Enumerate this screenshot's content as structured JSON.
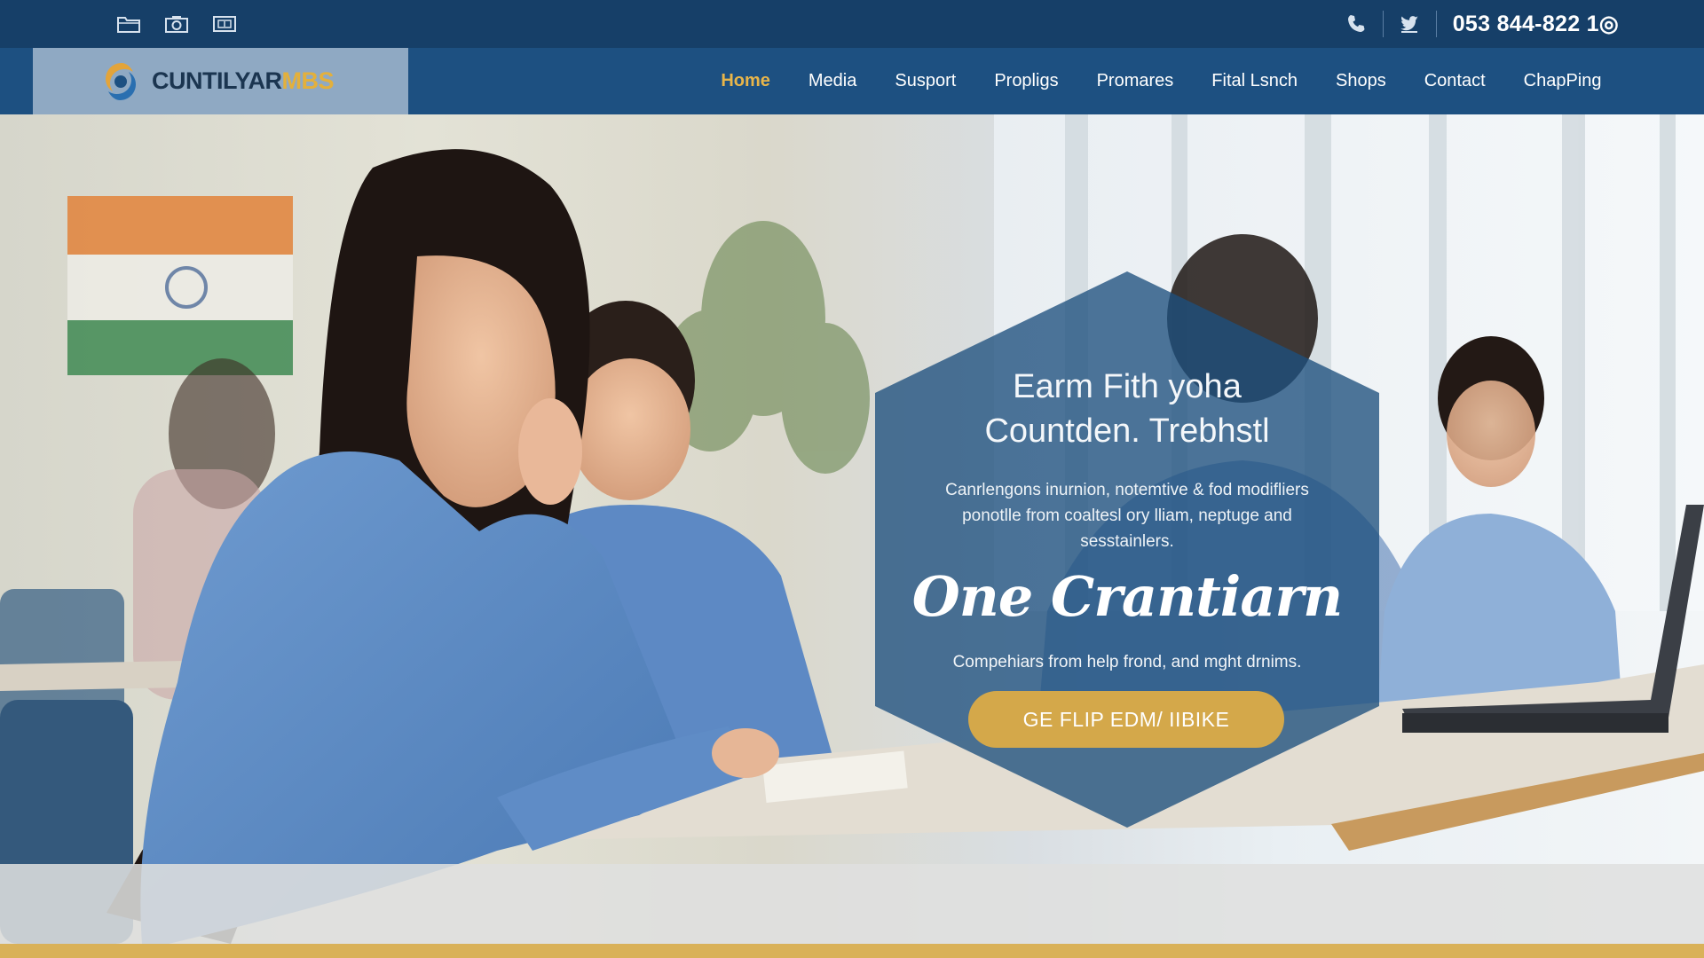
{
  "topbar": {
    "left_icons": [
      "folder-icon",
      "camera-icon",
      "ticket-icon"
    ],
    "right_icons": [
      "phone-icon",
      "twitter-icon"
    ],
    "phone": "053 844-822 1◎"
  },
  "brand": {
    "logo_text_a": "CUNTILYAR",
    "logo_text_b": "MBS",
    "colors": {
      "primary": "#1d5081",
      "dark": "#163f68",
      "gold": "#d4a84a",
      "logo_box": "#8fa9c3"
    }
  },
  "nav": {
    "items": [
      {
        "label": "Home",
        "active": true
      },
      {
        "label": "Media"
      },
      {
        "label": "Susport"
      },
      {
        "label": "Propligs"
      },
      {
        "label": "Promares"
      },
      {
        "label": "Fital Lsnch"
      },
      {
        "label": "Shops"
      },
      {
        "label": "Contact"
      },
      {
        "label": "ChapPing"
      }
    ]
  },
  "hero": {
    "title_line1": "Earm Fith yoha",
    "title_line2": "Countden. Trebhstl",
    "description_line1": "Canrlengons inurnion, notemtive & fod modifliers",
    "description_line2": "ponotlle from coaltesl ory lliam, neptuge and",
    "description_line3": "sesstainlers.",
    "script_heading": "One Crantiarn",
    "subheading": "Compehiars from help frond, and mght drnims.",
    "cta_label": "GE FLIP EDM/ IIBIKE"
  }
}
